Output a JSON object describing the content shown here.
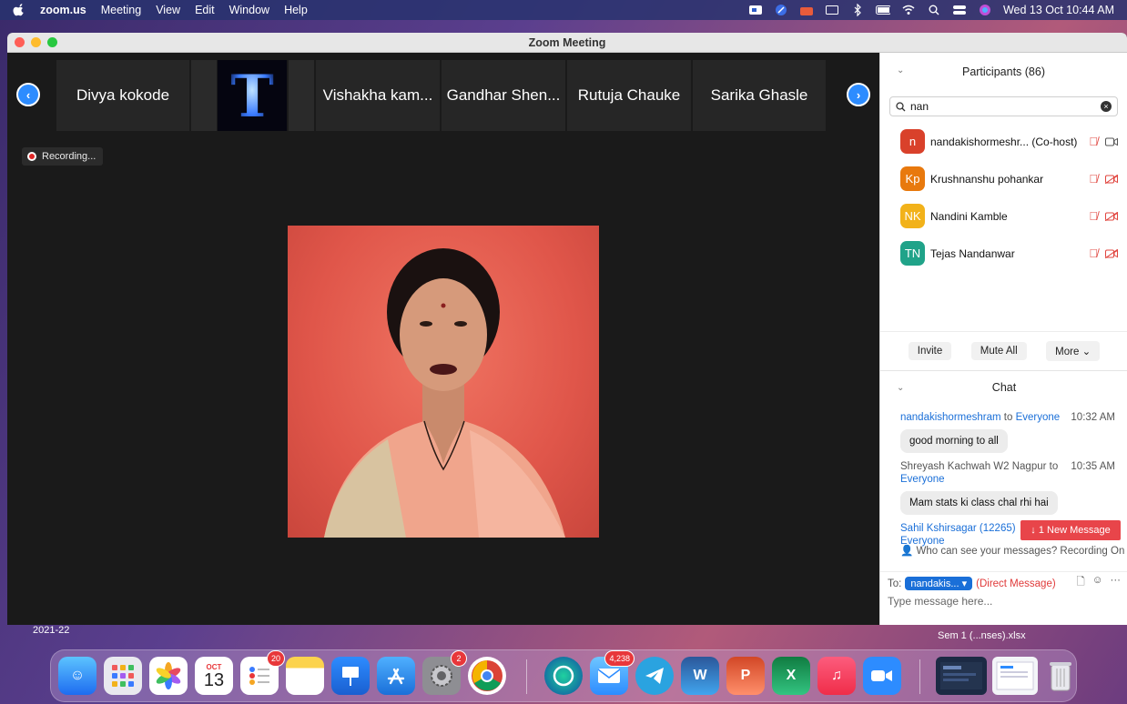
{
  "menubar": {
    "app": "zoom.us",
    "items": [
      "Meeting",
      "View",
      "Edit",
      "Window",
      "Help"
    ],
    "clock": "Wed 13 Oct  10:44 AM"
  },
  "window": {
    "title": "Zoom Meeting"
  },
  "strip": {
    "tiles": [
      "Divya kokode",
      "",
      "Vishakha kam...",
      "Gandhar Shen...",
      "Rutuja Chauke",
      "Sarika Ghasle"
    ],
    "t_letter": "T"
  },
  "recording": {
    "label": "Recording..."
  },
  "participants": {
    "title": "Participants (86)",
    "search_value": "nan",
    "list": [
      {
        "initials": "n",
        "name": "nandakishormeshr...  (Co-host)",
        "color": "#d9412b"
      },
      {
        "initials": "Kp",
        "name": "Krushnanshu pohankar",
        "color": "#e8790d"
      },
      {
        "initials": "NK",
        "name": "Nandini Kamble",
        "color": "#f2b21a"
      },
      {
        "initials": "TN",
        "name": "Tejas Nandanwar",
        "color": "#20a389"
      }
    ],
    "actions": {
      "invite": "Invite",
      "mute_all": "Mute All",
      "more": "More"
    }
  },
  "chat": {
    "title": "Chat",
    "messages": [
      {
        "from": "nandakishormeshram",
        "to_word": "to",
        "to": "Everyone",
        "time": "10:32 AM",
        "text": "good morning  to all"
      },
      {
        "from": "Shreyash Kachwah W2 Nagpur to",
        "to": "Everyone",
        "time": "10:35 AM",
        "text": "Mam stats ki class chal rhi hai"
      },
      {
        "from": "Sahil Kshirsagar (12265)",
        "to": "Everyone"
      }
    ],
    "new_message": "↓ 1 New Message",
    "visibility": "Who can see your messages? Recording On",
    "to_label": "To:",
    "to_target": "nandakis...",
    "direct": "(Direct Message)",
    "placeholder": "Type message here..."
  },
  "desktop": {
    "left_label": "2021-22",
    "right_label": "Sem 1 (...nses).xlsx"
  },
  "dock": {
    "calendar_month": "OCT",
    "calendar_day": "13",
    "reminders_badge": "20",
    "settings_badge": "2",
    "mail_badge": "4,238"
  }
}
